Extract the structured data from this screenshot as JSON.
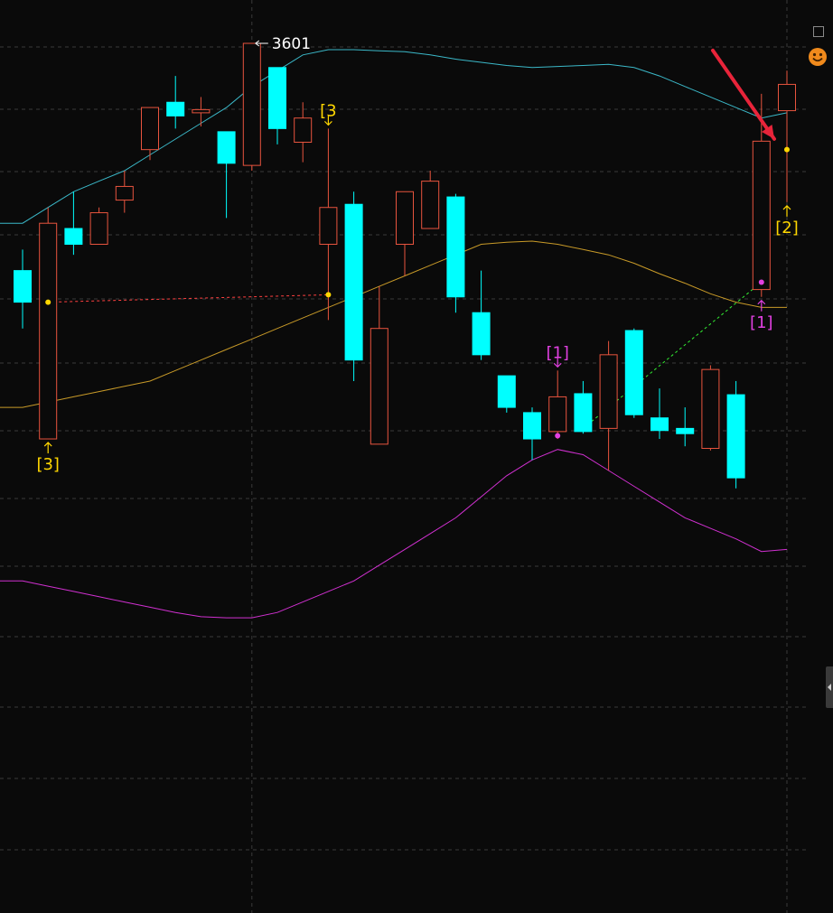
{
  "chart_data": {
    "type": "candlestick",
    "title": "",
    "xlabel": "",
    "ylabel": "",
    "ylim": [
      2815,
      3640
    ],
    "grid": true,
    "candles": [
      {
        "o": 3385,
        "h": 3405,
        "l": 3330,
        "c": 3355
      },
      {
        "o": 3225,
        "h": 3445,
        "l": 3225,
        "c": 3430
      },
      {
        "o": 3425,
        "h": 3460,
        "l": 3400,
        "c": 3410
      },
      {
        "o": 3410,
        "h": 3445,
        "l": 3410,
        "c": 3440
      },
      {
        "o": 3452,
        "h": 3480,
        "l": 3440,
        "c": 3465
      },
      {
        "o": 3500,
        "h": 3540,
        "l": 3490,
        "c": 3540
      },
      {
        "o": 3545,
        "h": 3570,
        "l": 3520,
        "c": 3532
      },
      {
        "o": 3535,
        "h": 3550,
        "l": 3522,
        "c": 3538
      },
      {
        "o": 3517,
        "h": 3517,
        "l": 3435,
        "c": 3487
      },
      {
        "o": 3485,
        "h": 3601,
        "l": 3480,
        "c": 3601
      },
      {
        "o": 3578,
        "h": 3578,
        "l": 3505,
        "c": 3520
      },
      {
        "o": 3507,
        "h": 3545,
        "l": 3488,
        "c": 3530
      },
      {
        "o": 3410,
        "h": 3520,
        "l": 3338,
        "c": 3445
      },
      {
        "o": 3448,
        "h": 3460,
        "l": 3280,
        "c": 3300
      },
      {
        "o": 3220,
        "h": 3370,
        "l": 3220,
        "c": 3330
      },
      {
        "o": 3410,
        "h": 3460,
        "l": 3380,
        "c": 3460
      },
      {
        "o": 3425,
        "h": 3480,
        "l": 3425,
        "c": 3470
      },
      {
        "o": 3455,
        "h": 3458,
        "l": 3345,
        "c": 3360
      },
      {
        "o": 3345,
        "h": 3385,
        "l": 3300,
        "c": 3305
      },
      {
        "o": 3285,
        "h": 3285,
        "l": 3250,
        "c": 3255
      },
      {
        "o": 3250,
        "h": 3255,
        "l": 3205,
        "c": 3225
      },
      {
        "o": 3232,
        "h": 3290,
        "l": 3225,
        "c": 3265
      },
      {
        "o": 3268,
        "h": 3280,
        "l": 3230,
        "c": 3232
      },
      {
        "o": 3235,
        "h": 3318,
        "l": 3195,
        "c": 3305
      },
      {
        "o": 3328,
        "h": 3330,
        "l": 3245,
        "c": 3248
      },
      {
        "o": 3245,
        "h": 3273,
        "l": 3225,
        "c": 3233
      },
      {
        "o": 3235,
        "h": 3255,
        "l": 3218,
        "c": 3230
      },
      {
        "o": 3216,
        "h": 3295,
        "l": 3214,
        "c": 3291
      },
      {
        "o": 3267,
        "h": 3280,
        "l": 3178,
        "c": 3188
      },
      {
        "o": 3367,
        "h": 3553,
        "l": 3360,
        "c": 3508
      },
      {
        "o": 3537,
        "h": 3575,
        "l": 3450,
        "c": 3562
      }
    ],
    "bands": {
      "upper": [
        3430,
        3445,
        3460,
        3470,
        3480,
        3495,
        3510,
        3525,
        3540,
        3560,
        3575,
        3590,
        3595,
        3595,
        3594,
        3593,
        3590,
        3586,
        3583,
        3580,
        3578,
        3579,
        3580,
        3581,
        3578,
        3570,
        3560,
        3550,
        3540,
        3530,
        3535
      ],
      "middle": [
        3255,
        3260,
        3265,
        3270,
        3275,
        3280,
        3290,
        3300,
        3310,
        3320,
        3330,
        3340,
        3350,
        3360,
        3370,
        3380,
        3390,
        3400,
        3410,
        3412,
        3413,
        3410,
        3405,
        3400,
        3392,
        3382,
        3373,
        3363,
        3355,
        3350,
        3350
      ],
      "lower": [
        3090,
        3085,
        3080,
        3075,
        3070,
        3065,
        3060,
        3056,
        3055,
        3055,
        3060,
        3070,
        3080,
        3090,
        3105,
        3120,
        3135,
        3150,
        3170,
        3190,
        3205,
        3215,
        3210,
        3195,
        3180,
        3165,
        3150,
        3140,
        3130,
        3118,
        3120
      ]
    },
    "markers": [
      {
        "index": 1,
        "label": "[3]",
        "color": "#ffd700",
        "side": "below"
      },
      {
        "index": 12,
        "label": "[3",
        "color": "#ffd700",
        "side": "above"
      },
      {
        "index": 21,
        "label": "[1]",
        "color": "#e040e0",
        "side": "above"
      },
      {
        "index": 29,
        "label": "[1]",
        "color": "#e040e0",
        "side": "below"
      },
      {
        "index": 30,
        "label": "[2]",
        "color": "#ffd700",
        "side": "below"
      }
    ],
    "dots": [
      {
        "index": 1,
        "value": 3355,
        "color": "#ffd700"
      },
      {
        "index": 12,
        "value": 3362,
        "color": "#ffd700"
      },
      {
        "index": 21,
        "value": 3228,
        "color": "#e040e0"
      },
      {
        "index": 29,
        "value": 3374,
        "color": "#e040e0"
      },
      {
        "index": 30,
        "value": 3500,
        "color": "#ffd700"
      }
    ],
    "trend_lines": [
      {
        "from_index": 1,
        "from_value": 3355,
        "to_index": 12,
        "to_value": 3362,
        "color": "#ff4040"
      },
      {
        "from_index": 22,
        "from_value": 3235,
        "to_index": 29,
        "to_value": 3374,
        "color": "#33ee33"
      }
    ],
    "high_label": {
      "index": 9,
      "value": 3601,
      "text": "3601"
    },
    "arrow_target": {
      "index": 30,
      "value": 3505,
      "color": "#e8243a"
    },
    "colors": {
      "background": "#0a0a0a",
      "grid": "#3a3a3a",
      "up": "#e8543e",
      "down": "#00ffff",
      "upper_band": "#3bb8c8",
      "middle_band": "#c89a28",
      "lower_band": "#d030d0",
      "label": "#ffffff"
    }
  },
  "icons": {
    "corner": "square-icon",
    "face": "smiley-icon",
    "side": "collapse-tab-icon"
  }
}
